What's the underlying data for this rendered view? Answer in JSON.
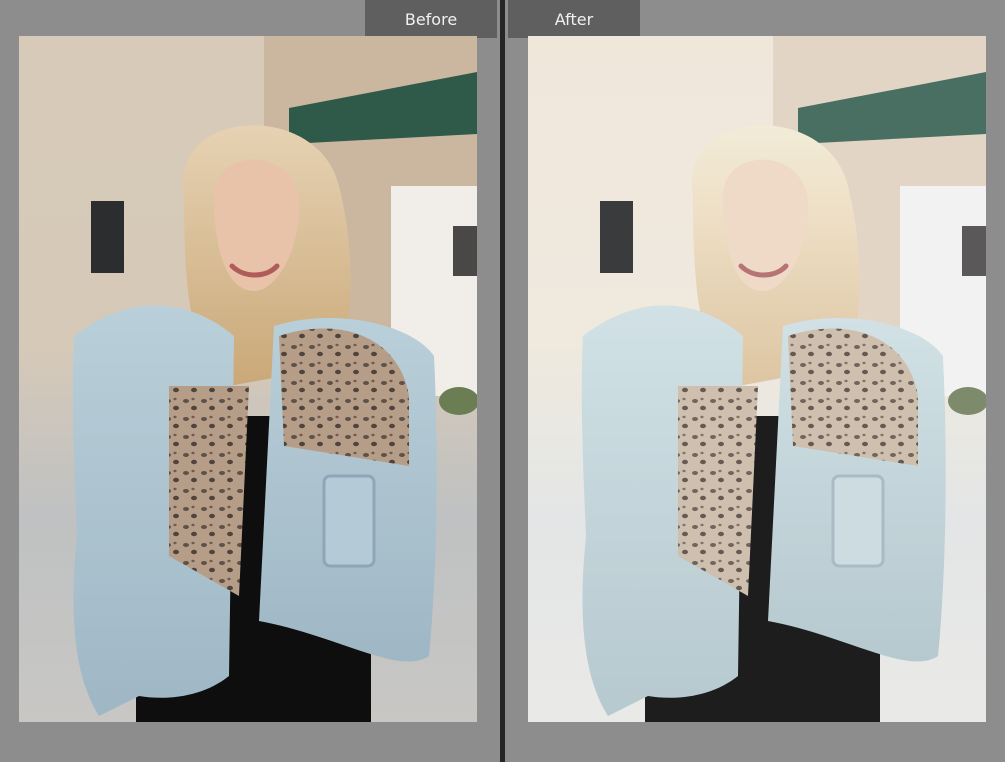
{
  "comparison": {
    "before_label": "Before",
    "after_label": "After"
  },
  "colors": {
    "frame_background": "#8d8d8d",
    "label_background": "#5f5f5f",
    "label_text": "#f1f1f1",
    "divider": "#262626"
  }
}
